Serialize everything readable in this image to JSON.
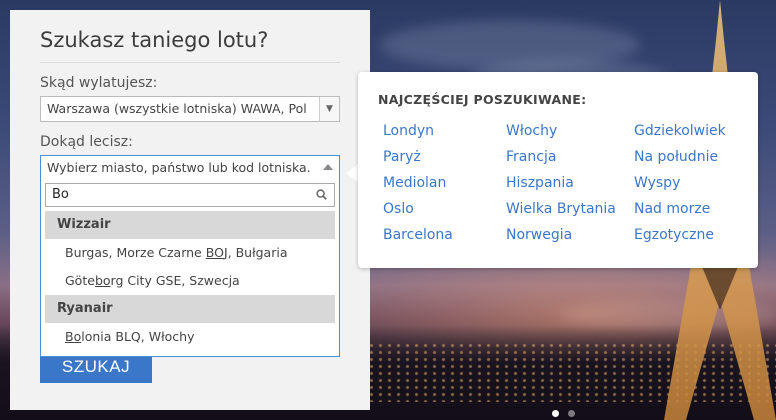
{
  "search_panel": {
    "title": "Szukasz taniego lotu?",
    "from_label": "Skąd wylatujesz:",
    "from_value": "Warszawa (wszystkie lotniska) WAWA, Pol",
    "to_label": "Dokąd lecisz:",
    "to_placeholder": "Wybierz miasto, państwo lub kod lotniska.",
    "search_button": "SZUKAJ"
  },
  "dropdown": {
    "query": "Bo",
    "groups": [
      {
        "name": "Wizzair",
        "items": [
          {
            "before": "Burgas, Morze Czarne ",
            "match": "BO",
            "after": "J, Bułgaria"
          },
          {
            "before": "Göte",
            "match": "bo",
            "after": "rg City GSE, Szwecja"
          }
        ]
      },
      {
        "name": "Ryanair",
        "items": [
          {
            "before": "",
            "match": "Bo",
            "after": "lonia BLQ, Włochy"
          }
        ]
      }
    ]
  },
  "popular": {
    "title": "NAJCZĘŚCIEJ POSZUKIWANE:",
    "links": [
      "Londyn",
      "Włochy",
      "Gdziekolwiek",
      "Paryż",
      "Francja",
      "Na południe",
      "Mediolan",
      "Hiszpania",
      "Wyspy",
      "Oslo",
      "Wielka Brytania",
      "Nad morze",
      "Barcelona",
      "Norwegia",
      "Egzotyczne"
    ]
  },
  "colors": {
    "accent": "#3a77c9",
    "panel_bg": "#f2f2f2",
    "group_bg": "#d8d8d8"
  }
}
